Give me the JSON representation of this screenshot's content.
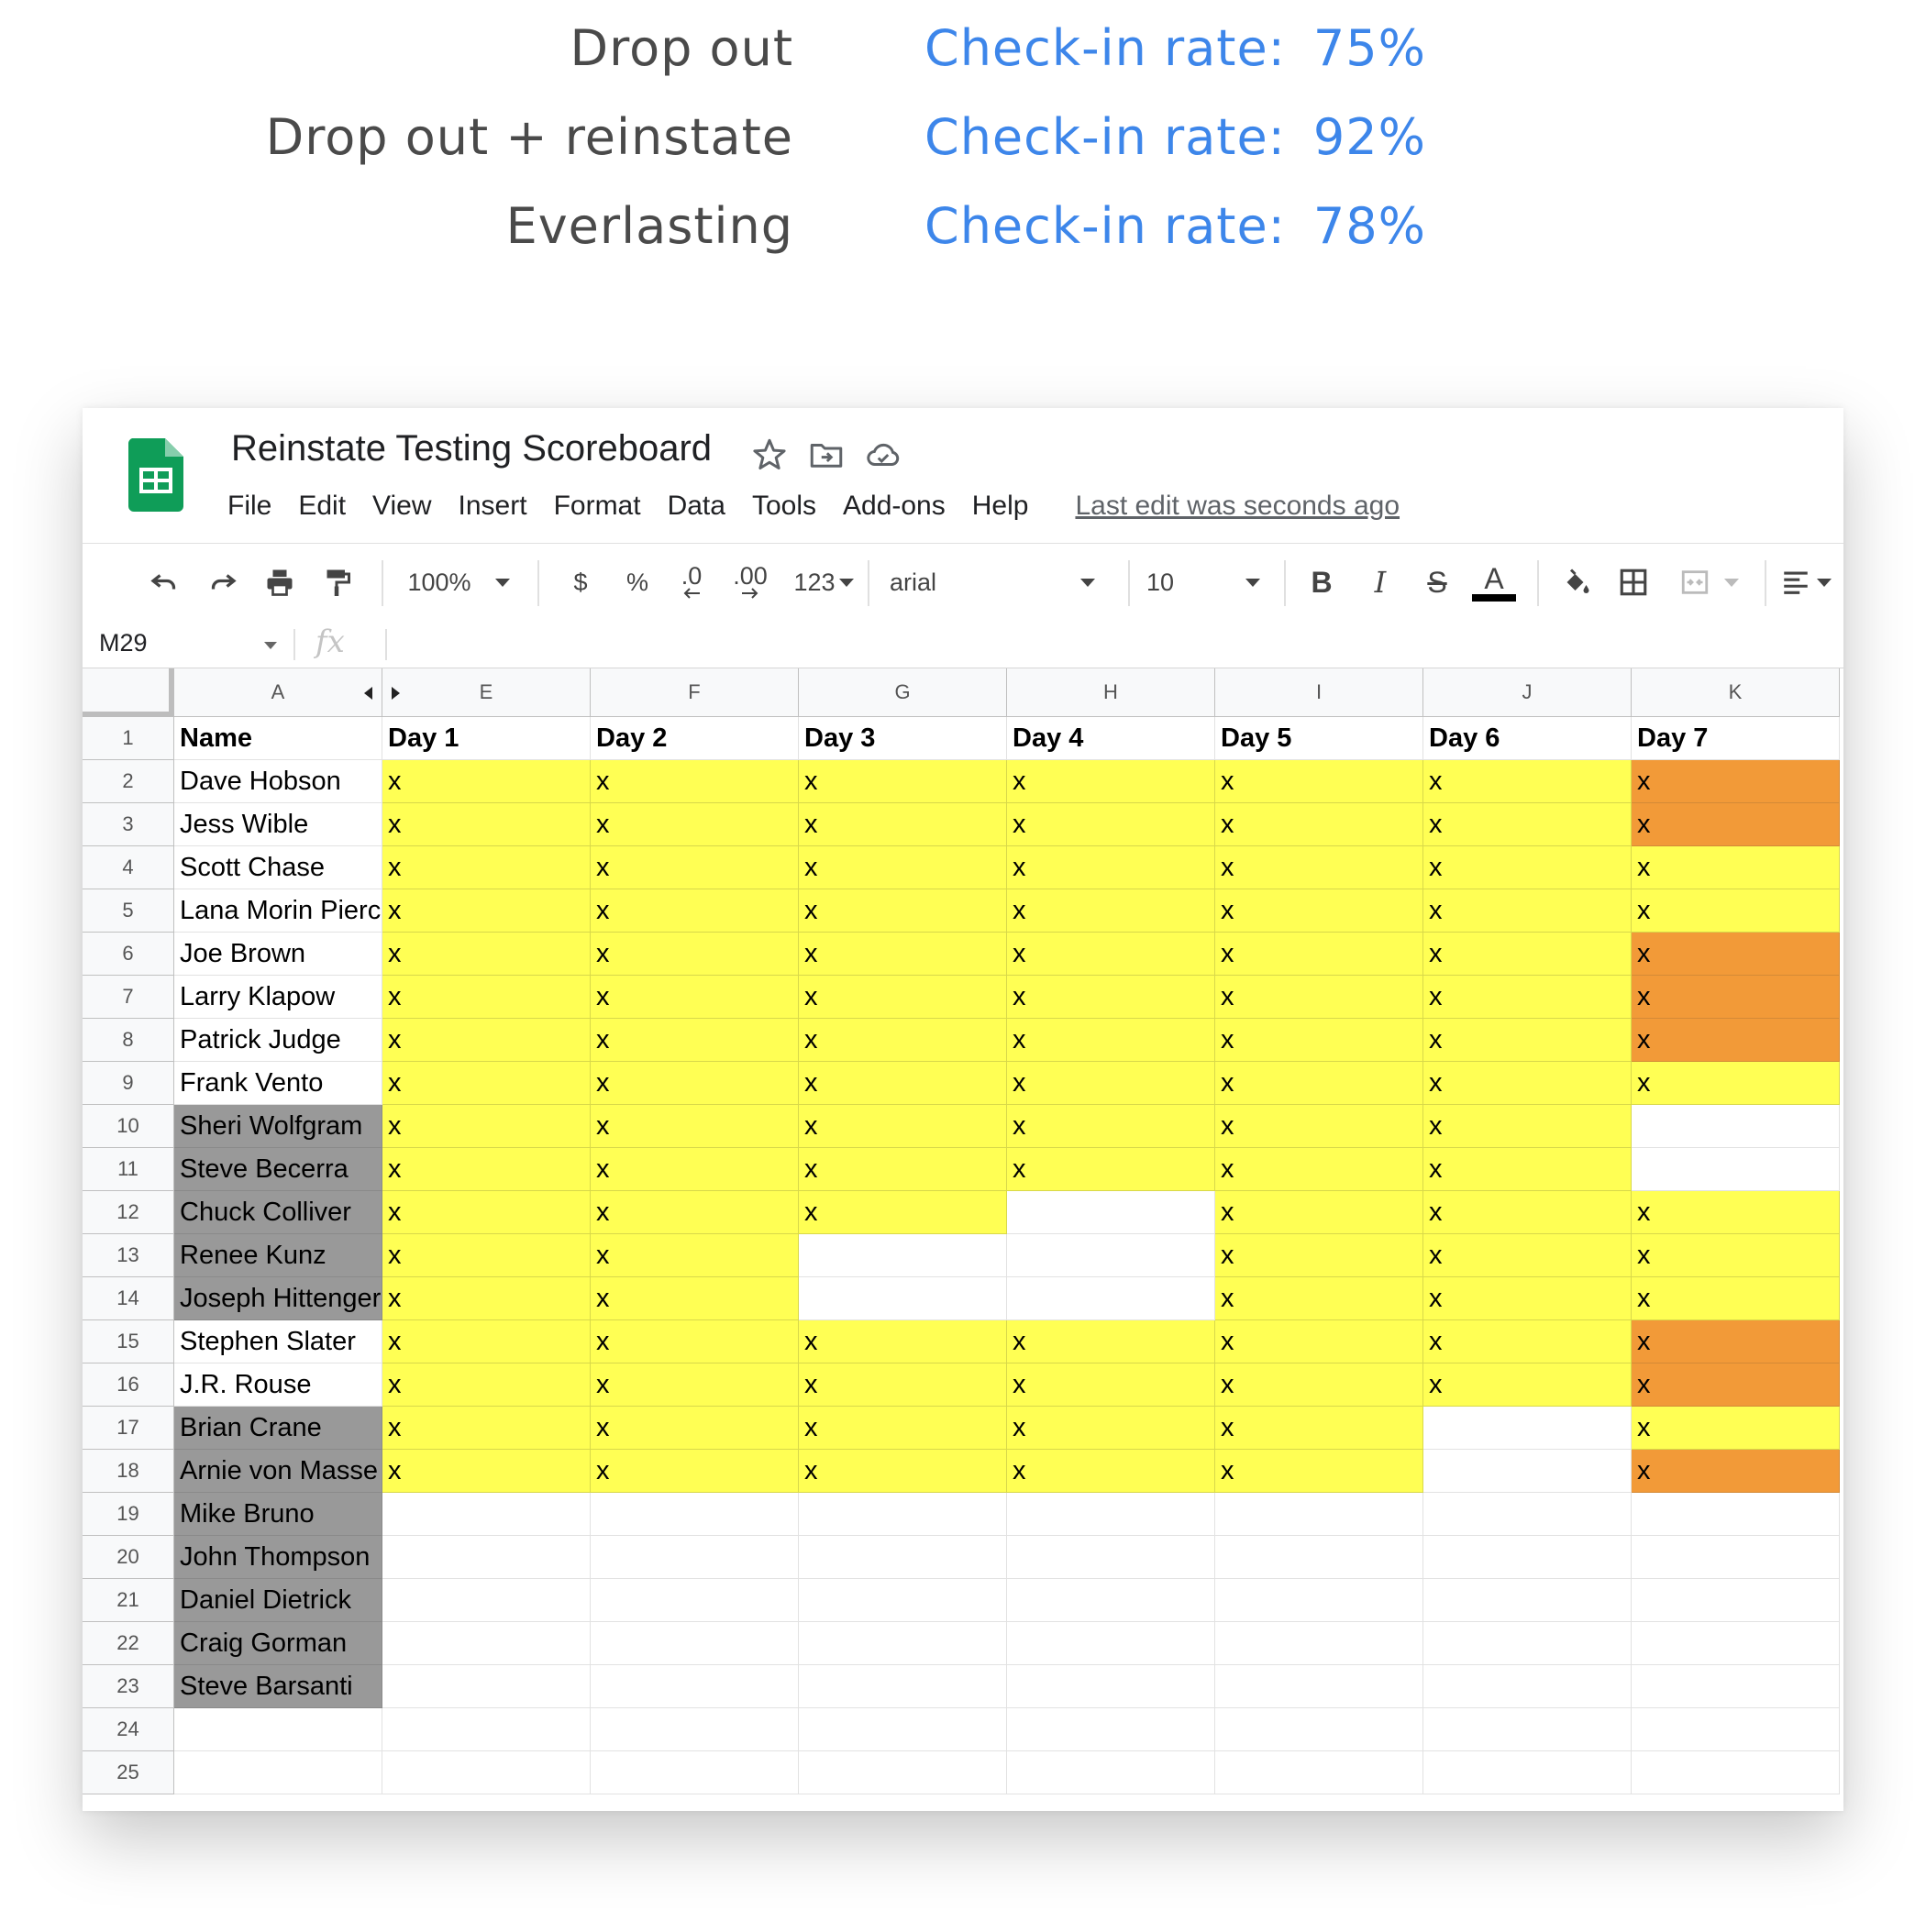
{
  "summary": [
    {
      "label": "Drop out",
      "rate_label": "Check-in rate:",
      "rate_value": "75%"
    },
    {
      "label": "Drop out + reinstate",
      "rate_label": "Check-in rate:",
      "rate_value": "92%"
    },
    {
      "label": "Everlasting",
      "rate_label": "Check-in rate:",
      "rate_value": "78%"
    }
  ],
  "colors": {
    "accent": "#3d86ea",
    "highlight_yellow": "#ffff54",
    "highlight_orange": "#f29a38",
    "dropped_gray": "#999999",
    "sheets_green": "#0f9d58"
  },
  "app": {
    "title": "Reinstate Testing Scoreboard",
    "title_icons": [
      "star-icon",
      "move-to-folder-icon",
      "cloud-status-icon"
    ],
    "menu": [
      "File",
      "Edit",
      "View",
      "Insert",
      "Format",
      "Data",
      "Tools",
      "Add-ons",
      "Help"
    ],
    "last_edit": "Last edit was seconds ago"
  },
  "toolbar": {
    "zoom": "100%",
    "currency": "$",
    "percent": "%",
    "decrease_decimal": ".0",
    "increase_decimal": ".00",
    "more_formats": "123",
    "font": "arial",
    "font_size": "10",
    "bold": "B",
    "italic": "I",
    "strikethrough": "S",
    "text_color": "A"
  },
  "formula_bar": {
    "cell_ref": "M29",
    "fx": "fx",
    "formula": ""
  },
  "grid": {
    "column_letters": [
      "A",
      "E",
      "F",
      "G",
      "H",
      "I",
      "J",
      "K"
    ],
    "header_row": [
      "Name",
      "Day 1",
      "Day 2",
      "Day 3",
      "Day 4",
      "Day 5",
      "Day 6",
      "Day 7"
    ],
    "rows": [
      {
        "num": "1",
        "name": "Name",
        "g": false,
        "days": []
      },
      {
        "num": "2",
        "name": "Dave Hobson",
        "g": false,
        "days": [
          [
            "x",
            "y"
          ],
          [
            "x",
            "y"
          ],
          [
            "x",
            "y"
          ],
          [
            "x",
            "y"
          ],
          [
            "x",
            "y"
          ],
          [
            "x",
            "y"
          ],
          [
            "x",
            "o"
          ]
        ]
      },
      {
        "num": "3",
        "name": "Jess Wible",
        "g": false,
        "days": [
          [
            "x",
            "y"
          ],
          [
            "x",
            "y"
          ],
          [
            "x",
            "y"
          ],
          [
            "x",
            "y"
          ],
          [
            "x",
            "y"
          ],
          [
            "x",
            "y"
          ],
          [
            "x",
            "o"
          ]
        ]
      },
      {
        "num": "4",
        "name": "Scott Chase",
        "g": false,
        "days": [
          [
            "x",
            "y"
          ],
          [
            "x",
            "y"
          ],
          [
            "x",
            "y"
          ],
          [
            "x",
            "y"
          ],
          [
            "x",
            "y"
          ],
          [
            "x",
            "y"
          ],
          [
            "x",
            "y"
          ]
        ]
      },
      {
        "num": "5",
        "name": "Lana Morin Pierce",
        "g": false,
        "days": [
          [
            "x",
            "y"
          ],
          [
            "x",
            "y"
          ],
          [
            "x",
            "y"
          ],
          [
            "x",
            "y"
          ],
          [
            "x",
            "y"
          ],
          [
            "x",
            "y"
          ],
          [
            "x",
            "y"
          ]
        ]
      },
      {
        "num": "6",
        "name": "Joe Brown",
        "g": false,
        "days": [
          [
            "x",
            "y"
          ],
          [
            "x",
            "y"
          ],
          [
            "x",
            "y"
          ],
          [
            "x",
            "y"
          ],
          [
            "x",
            "y"
          ],
          [
            "x",
            "y"
          ],
          [
            "x",
            "o"
          ]
        ]
      },
      {
        "num": "7",
        "name": "Larry Klapow",
        "g": false,
        "days": [
          [
            "x",
            "y"
          ],
          [
            "x",
            "y"
          ],
          [
            "x",
            "y"
          ],
          [
            "x",
            "y"
          ],
          [
            "x",
            "y"
          ],
          [
            "x",
            "y"
          ],
          [
            "x",
            "o"
          ]
        ]
      },
      {
        "num": "8",
        "name": "Patrick Judge",
        "g": false,
        "days": [
          [
            "x",
            "y"
          ],
          [
            "x",
            "y"
          ],
          [
            "x",
            "y"
          ],
          [
            "x",
            "y"
          ],
          [
            "x",
            "y"
          ],
          [
            "x",
            "y"
          ],
          [
            "x",
            "o"
          ]
        ]
      },
      {
        "num": "9",
        "name": "Frank Vento",
        "g": false,
        "days": [
          [
            "x",
            "y"
          ],
          [
            "x",
            "y"
          ],
          [
            "x",
            "y"
          ],
          [
            "x",
            "y"
          ],
          [
            "x",
            "y"
          ],
          [
            "x",
            "y"
          ],
          [
            "x",
            "y"
          ]
        ]
      },
      {
        "num": "10",
        "name": "Sheri Wolfgram",
        "g": true,
        "days": [
          [
            "x",
            "y"
          ],
          [
            "x",
            "y"
          ],
          [
            "x",
            "y"
          ],
          [
            "x",
            "y"
          ],
          [
            "x",
            "y"
          ],
          [
            "x",
            "y"
          ],
          [
            "",
            ""
          ]
        ]
      },
      {
        "num": "11",
        "name": "Steve Becerra",
        "g": true,
        "days": [
          [
            "x",
            "y"
          ],
          [
            "x",
            "y"
          ],
          [
            "x",
            "y"
          ],
          [
            "x",
            "y"
          ],
          [
            "x",
            "y"
          ],
          [
            "x",
            "y"
          ],
          [
            "",
            ""
          ]
        ]
      },
      {
        "num": "12",
        "name": "Chuck Colliver",
        "g": true,
        "days": [
          [
            "x",
            "y"
          ],
          [
            "x",
            "y"
          ],
          [
            "x",
            "y"
          ],
          [
            "",
            ""
          ],
          [
            "x",
            "y"
          ],
          [
            "x",
            "y"
          ],
          [
            "x",
            "y"
          ]
        ]
      },
      {
        "num": "13",
        "name": "Renee Kunz",
        "g": true,
        "days": [
          [
            "x",
            "y"
          ],
          [
            "x",
            "y"
          ],
          [
            "",
            ""
          ],
          [
            "",
            ""
          ],
          [
            "x",
            "y"
          ],
          [
            "x",
            "y"
          ],
          [
            "x",
            "y"
          ]
        ]
      },
      {
        "num": "14",
        "name": "Joseph Hittenger",
        "g": true,
        "days": [
          [
            "x",
            "y"
          ],
          [
            "x",
            "y"
          ],
          [
            "",
            ""
          ],
          [
            "",
            ""
          ],
          [
            "x",
            "y"
          ],
          [
            "x",
            "y"
          ],
          [
            "x",
            "y"
          ]
        ]
      },
      {
        "num": "15",
        "name": "Stephen Slater",
        "g": false,
        "days": [
          [
            "x",
            "y"
          ],
          [
            "x",
            "y"
          ],
          [
            "x",
            "y"
          ],
          [
            "x",
            "y"
          ],
          [
            "x",
            "y"
          ],
          [
            "x",
            "y"
          ],
          [
            "x",
            "o"
          ]
        ]
      },
      {
        "num": "16",
        "name": "J.R. Rouse",
        "g": false,
        "days": [
          [
            "x",
            "y"
          ],
          [
            "x",
            "y"
          ],
          [
            "x",
            "y"
          ],
          [
            "x",
            "y"
          ],
          [
            "x",
            "y"
          ],
          [
            "x",
            "y"
          ],
          [
            "x",
            "o"
          ]
        ]
      },
      {
        "num": "17",
        "name": "Brian Crane",
        "g": true,
        "days": [
          [
            "x",
            "y"
          ],
          [
            "x",
            "y"
          ],
          [
            "x",
            "y"
          ],
          [
            "x",
            "y"
          ],
          [
            "x",
            "y"
          ],
          [
            "",
            ""
          ],
          [
            "x",
            "y"
          ]
        ]
      },
      {
        "num": "18",
        "name": "Arnie von Masse",
        "g": true,
        "days": [
          [
            "x",
            "y"
          ],
          [
            "x",
            "y"
          ],
          [
            "x",
            "y"
          ],
          [
            "x",
            "y"
          ],
          [
            "x",
            "y"
          ],
          [
            "",
            ""
          ],
          [
            "x",
            "o"
          ]
        ]
      },
      {
        "num": "19",
        "name": "Mike Bruno",
        "g": true,
        "days": []
      },
      {
        "num": "20",
        "name": "John Thompson",
        "g": true,
        "days": []
      },
      {
        "num": "21",
        "name": "Daniel Dietrick",
        "g": true,
        "days": []
      },
      {
        "num": "22",
        "name": "Craig Gorman",
        "g": true,
        "days": []
      },
      {
        "num": "23",
        "name": "Steve Barsanti",
        "g": true,
        "days": []
      },
      {
        "num": "24",
        "name": "",
        "g": false,
        "days": []
      },
      {
        "num": "25",
        "name": "",
        "g": false,
        "days": []
      }
    ]
  }
}
